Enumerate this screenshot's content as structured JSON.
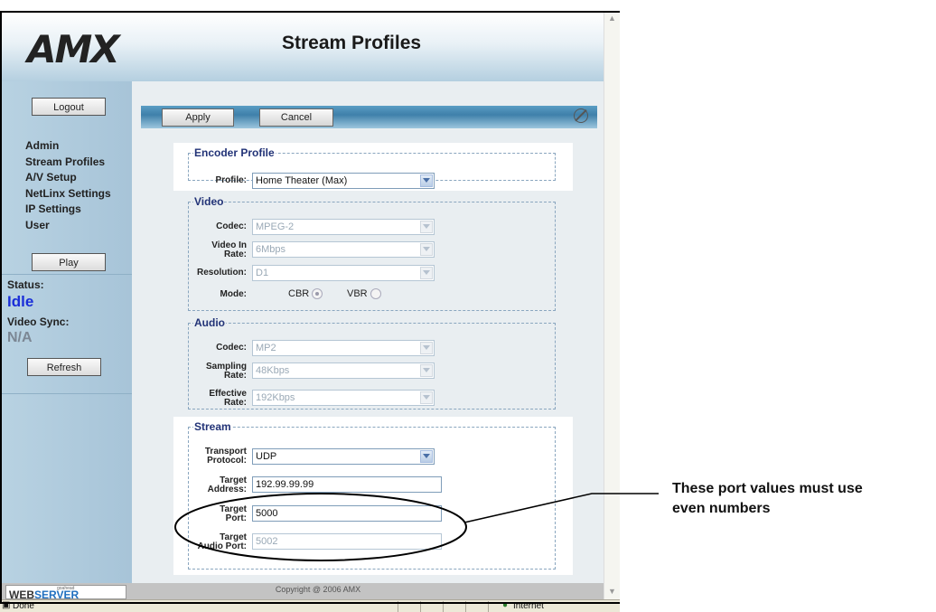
{
  "header": {
    "logo": "AMX",
    "title": "Stream Profiles"
  },
  "nav": {
    "logout": "Logout",
    "items": [
      "Admin",
      "Stream Profiles",
      "A/V Setup",
      "NetLinx Settings",
      "IP Settings",
      "User"
    ],
    "play": "Play",
    "status_label": "Status:",
    "status_value": "Idle",
    "sync_label": "Video Sync:",
    "sync_value": "N/A",
    "refresh": "Refresh"
  },
  "toolbar": {
    "apply": "Apply",
    "cancel": "Cancel"
  },
  "encoder": {
    "legend": "Encoder Profile",
    "profile_label": "Profile:",
    "profile_value": "Home Theater (Max)"
  },
  "video": {
    "legend": "Video",
    "codec_label": "Codec:",
    "codec_value": "MPEG-2",
    "rate_label_1": "Video In",
    "rate_label_2": "Rate:",
    "rate_value": "6Mbps",
    "res_label": "Resolution:",
    "res_value": "D1",
    "mode_label": "Mode:",
    "mode_cbr": "CBR",
    "mode_vbr": "VBR",
    "mode_selected": "CBR"
  },
  "audio": {
    "legend": "Audio",
    "codec_label": "Codec:",
    "codec_value": "MP2",
    "sampling_label_1": "Sampling",
    "sampling_label_2": "Rate:",
    "sampling_value": "48Kbps",
    "effective_label_1": "Effective",
    "effective_label_2": "Rate:",
    "effective_value": "192Kbps"
  },
  "stream": {
    "legend": "Stream",
    "transport_label_1": "Transport",
    "transport_label_2": "Protocol:",
    "transport_value": "UDP",
    "address_label_1": "Target",
    "address_label_2": "Address:",
    "address_value": "192.99.99.99",
    "port_label_1": "Target",
    "port_label_2": "Port:",
    "port_value": "5000",
    "audio_port_label_1": "Target",
    "audio_port_label_2": "Audio Port:",
    "audio_port_value": "5002"
  },
  "footer": {
    "ws_small": "goahead",
    "ws_web": "WEB",
    "ws_server": "SERVER",
    "copyright": "Copyright @ 2006 AMX"
  },
  "statusbar": {
    "left": "Done",
    "zone": "Internet"
  },
  "callout": {
    "line1": "These port values must use",
    "line2": "even numbers"
  },
  "colors": {
    "status_value": "#1a2ed8",
    "sync_value": "#7c8794",
    "legend": "#223377",
    "toolbar": "#4a8bb5"
  }
}
